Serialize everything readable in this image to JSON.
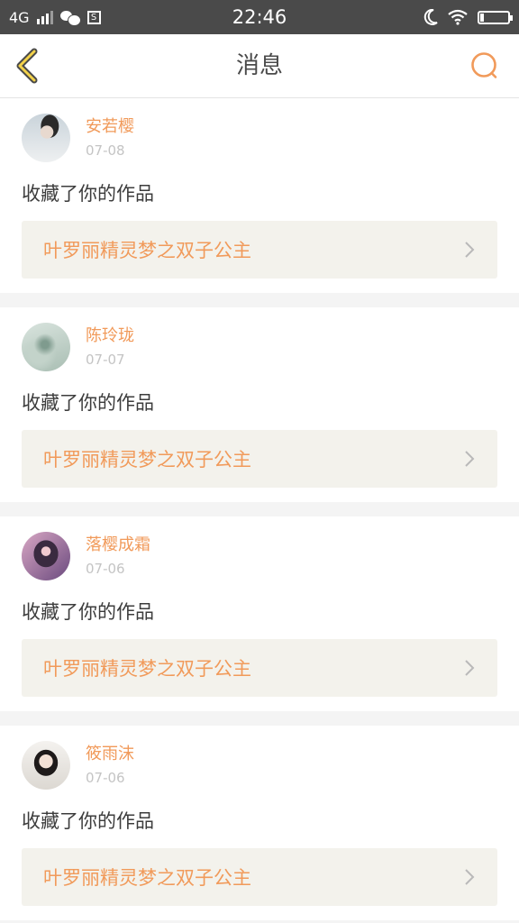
{
  "status_bar": {
    "network": "4G",
    "time": "22:46"
  },
  "nav": {
    "title": "消息"
  },
  "colors": {
    "accent": "#f19a5a",
    "status_bar": "#4a4a4a",
    "card_bg": "#ffffff",
    "work_bg": "#f3f2ec"
  },
  "messages": [
    {
      "user": "安若樱",
      "date": "07-08",
      "action": "收藏了你的作品",
      "work_title": "叶罗丽精灵梦之双子公主"
    },
    {
      "user": "陈玲珑",
      "date": "07-07",
      "action": "收藏了你的作品",
      "work_title": "叶罗丽精灵梦之双子公主"
    },
    {
      "user": "落樱成霜",
      "date": "07-06",
      "action": "收藏了你的作品",
      "work_title": "叶罗丽精灵梦之双子公主"
    },
    {
      "user": "筱雨沫",
      "date": "07-06",
      "action": "收藏了你的作品",
      "work_title": "叶罗丽精灵梦之双子公主"
    }
  ]
}
